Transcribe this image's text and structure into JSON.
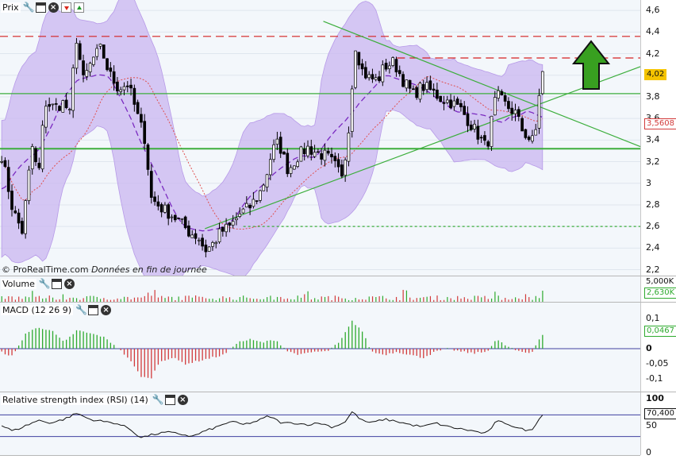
{
  "panels": {
    "price": {
      "title": "Prix"
    },
    "volume": {
      "title": "Volume"
    },
    "macd": {
      "title": "MACD (12 26 9)"
    },
    "rsi": {
      "title": "Relative strength index (RSI) (14)"
    }
  },
  "credit": {
    "brand": "© ProRealTime.com",
    "note": "Données en fin de journée"
  },
  "icons": {
    "wrench": "wrench-icon",
    "window": "window-icon",
    "close": "close-icon",
    "down": "down-arrow-icon",
    "up": "up-arrow-icon"
  },
  "colors": {
    "bollinger_fill": "#c9b6f0",
    "bollinger_mid": "#7a2ac0",
    "moving_average": "#e05050",
    "support_line": "#3cae3c",
    "trendline": "#3cae3c",
    "resistance_line": "#d42020",
    "macd_positive": "#2eaa2e",
    "macd_negative": "#d23b3b",
    "rsi_line": "#111111",
    "price_badge_bg": "#f5c400",
    "ma_badge_text": "#d23b3b",
    "volume_badge_text": "#2eaa2e",
    "macd_badge_text": "#2eaa2e",
    "big_arrow": "#38a020"
  },
  "chart_data": [
    {
      "type": "candlestick",
      "panel": "price",
      "title": "Prix",
      "y_ticks": [
        "4,6",
        "4,4",
        "4,2",
        "4",
        "3,8",
        "3,6",
        "3,4",
        "3,2",
        "3",
        "2,8",
        "2,6",
        "2,4",
        "2,2"
      ],
      "ylim": [
        2.16,
        4.66
      ],
      "last_price": "4,02",
      "moving_average_value": "3,5608",
      "resistance_levels": [
        4.36,
        4.16
      ],
      "support_levels": [
        3.83,
        3.32,
        2.6
      ],
      "trendlines": [
        {
          "from": [
            0.505,
            4.5
          ],
          "to": [
            1.0,
            3.34
          ],
          "style": "descending"
        },
        {
          "from": [
            0.32,
            2.58
          ],
          "to": [
            1.0,
            4.08
          ],
          "style": "ascending"
        }
      ],
      "close_profile": [
        [
          0.0,
          3.34
        ],
        [
          0.02,
          2.75
        ],
        [
          0.035,
          2.55
        ],
        [
          0.05,
          3.35
        ],
        [
          0.06,
          3.05
        ],
        [
          0.07,
          3.75
        ],
        [
          0.085,
          3.7
        ],
        [
          0.1,
          3.75
        ],
        [
          0.11,
          3.62
        ],
        [
          0.118,
          4.4
        ],
        [
          0.13,
          3.95
        ],
        [
          0.145,
          4.15
        ],
        [
          0.158,
          4.25
        ],
        [
          0.17,
          4.02
        ],
        [
          0.185,
          3.88
        ],
        [
          0.2,
          3.92
        ],
        [
          0.215,
          3.62
        ],
        [
          0.228,
          3.38
        ],
        [
          0.235,
          2.87
        ],
        [
          0.25,
          2.78
        ],
        [
          0.265,
          2.72
        ],
        [
          0.28,
          2.65
        ],
        [
          0.295,
          2.55
        ],
        [
          0.31,
          2.5
        ],
        [
          0.32,
          2.38
        ],
        [
          0.33,
          2.42
        ],
        [
          0.345,
          2.55
        ],
        [
          0.36,
          2.6
        ],
        [
          0.375,
          2.72
        ],
        [
          0.39,
          2.78
        ],
        [
          0.405,
          2.9
        ],
        [
          0.415,
          3.05
        ],
        [
          0.425,
          3.3
        ],
        [
          0.435,
          3.38
        ],
        [
          0.45,
          3.12
        ],
        [
          0.465,
          3.25
        ],
        [
          0.48,
          3.33
        ],
        [
          0.495,
          3.28
        ],
        [
          0.51,
          3.25
        ],
        [
          0.525,
          3.15
        ],
        [
          0.535,
          3.02
        ],
        [
          0.545,
          3.55
        ],
        [
          0.555,
          4.28
        ],
        [
          0.565,
          4.05
        ],
        [
          0.575,
          3.98
        ],
        [
          0.59,
          3.95
        ],
        [
          0.6,
          4.08
        ],
        [
          0.615,
          4.12
        ],
        [
          0.63,
          3.95
        ],
        [
          0.645,
          3.82
        ],
        [
          0.66,
          3.9
        ],
        [
          0.675,
          3.85
        ],
        [
          0.69,
          3.78
        ],
        [
          0.705,
          3.75
        ],
        [
          0.72,
          3.68
        ],
        [
          0.735,
          3.55
        ],
        [
          0.75,
          3.42
        ],
        [
          0.76,
          3.32
        ],
        [
          0.775,
          3.82
        ],
        [
          0.79,
          3.72
        ],
        [
          0.805,
          3.65
        ],
        [
          0.815,
          3.5
        ],
        [
          0.825,
          3.42
        ],
        [
          0.835,
          3.38
        ],
        [
          0.845,
          4.02
        ]
      ]
    },
    {
      "type": "bar",
      "panel": "volume",
      "title": "Volume",
      "y_ticks": [
        "5,000K"
      ],
      "last_value": "2,630K"
    },
    {
      "type": "bar",
      "panel": "macd",
      "title": "MACD (12 26 9)",
      "y_ticks": [
        "0,1",
        "0,05",
        "0",
        "-0,05",
        "-0,1"
      ],
      "ylim": [
        -0.13,
        0.13
      ],
      "last_value": "0,0467",
      "profile": [
        [
          0.0,
          -0.01
        ],
        [
          0.02,
          -0.025
        ],
        [
          0.04,
          0.05
        ],
        [
          0.06,
          0.07
        ],
        [
          0.08,
          0.06
        ],
        [
          0.1,
          0.02
        ],
        [
          0.12,
          0.06
        ],
        [
          0.14,
          0.05
        ],
        [
          0.16,
          0.04
        ],
        [
          0.18,
          0.01
        ],
        [
          0.2,
          -0.03
        ],
        [
          0.22,
          -0.09
        ],
        [
          0.235,
          -0.1
        ],
        [
          0.25,
          -0.04
        ],
        [
          0.27,
          -0.03
        ],
        [
          0.29,
          -0.05
        ],
        [
          0.31,
          -0.04
        ],
        [
          0.33,
          -0.03
        ],
        [
          0.35,
          -0.02
        ],
        [
          0.37,
          0.02
        ],
        [
          0.39,
          0.03
        ],
        [
          0.41,
          0.02
        ],
        [
          0.43,
          0.03
        ],
        [
          0.45,
          -0.01
        ],
        [
          0.47,
          -0.02
        ],
        [
          0.49,
          -0.01
        ],
        [
          0.51,
          -0.01
        ],
        [
          0.53,
          0.02
        ],
        [
          0.55,
          0.09
        ],
        [
          0.565,
          0.06
        ],
        [
          0.58,
          -0.01
        ],
        [
          0.6,
          -0.02
        ],
        [
          0.62,
          -0.01
        ],
        [
          0.64,
          -0.02
        ],
        [
          0.66,
          -0.03
        ],
        [
          0.68,
          -0.01
        ],
        [
          0.7,
          0.0
        ],
        [
          0.72,
          -0.01
        ],
        [
          0.74,
          -0.015
        ],
        [
          0.76,
          -0.01
        ],
        [
          0.775,
          0.03
        ],
        [
          0.79,
          0.01
        ],
        [
          0.81,
          -0.01
        ],
        [
          0.83,
          -0.015
        ],
        [
          0.845,
          0.045
        ]
      ]
    },
    {
      "type": "line",
      "panel": "rsi",
      "title": "Relative strength index (RSI) (14)",
      "y_ticks": [
        "100",
        "50",
        "0"
      ],
      "ylim": [
        0,
        100
      ],
      "bands": [
        70,
        30
      ],
      "last_value": "70,400",
      "profile": [
        [
          0.0,
          52
        ],
        [
          0.02,
          40
        ],
        [
          0.04,
          50
        ],
        [
          0.06,
          60
        ],
        [
          0.08,
          55
        ],
        [
          0.1,
          62
        ],
        [
          0.12,
          73
        ],
        [
          0.14,
          62
        ],
        [
          0.16,
          58
        ],
        [
          0.18,
          55
        ],
        [
          0.2,
          46
        ],
        [
          0.22,
          28
        ],
        [
          0.24,
          34
        ],
        [
          0.26,
          38
        ],
        [
          0.28,
          35
        ],
        [
          0.3,
          30
        ],
        [
          0.32,
          40
        ],
        [
          0.34,
          48
        ],
        [
          0.36,
          58
        ],
        [
          0.38,
          52
        ],
        [
          0.4,
          58
        ],
        [
          0.42,
          68
        ],
        [
          0.44,
          55
        ],
        [
          0.46,
          55
        ],
        [
          0.48,
          52
        ],
        [
          0.5,
          55
        ],
        [
          0.52,
          47
        ],
        [
          0.54,
          58
        ],
        [
          0.55,
          76
        ],
        [
          0.565,
          60
        ],
        [
          0.58,
          55
        ],
        [
          0.6,
          62
        ],
        [
          0.62,
          58
        ],
        [
          0.64,
          52
        ],
        [
          0.66,
          48
        ],
        [
          0.68,
          55
        ],
        [
          0.7,
          48
        ],
        [
          0.72,
          44
        ],
        [
          0.74,
          40
        ],
        [
          0.76,
          35
        ],
        [
          0.775,
          58
        ],
        [
          0.79,
          55
        ],
        [
          0.81,
          45
        ],
        [
          0.83,
          40
        ],
        [
          0.845,
          70
        ]
      ]
    }
  ]
}
